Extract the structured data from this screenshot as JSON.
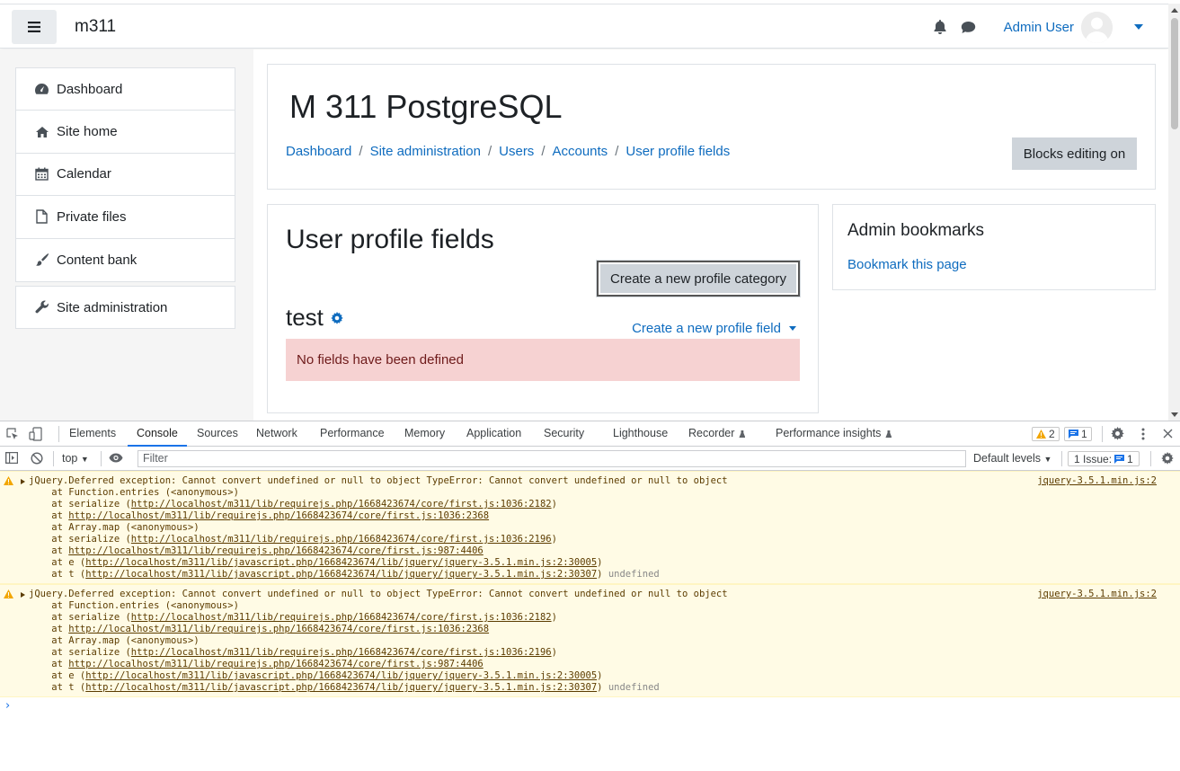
{
  "navbar": {
    "site_name": "m311",
    "user_name": "Admin User"
  },
  "drawer": {
    "items": [
      {
        "label": "Dashboard",
        "icon": "dashboard-icon"
      },
      {
        "label": "Site home",
        "icon": "home-icon"
      },
      {
        "label": "Calendar",
        "icon": "calendar-icon"
      },
      {
        "label": "Private files",
        "icon": "file-icon"
      },
      {
        "label": "Content bank",
        "icon": "paintbrush-icon"
      }
    ],
    "admin": {
      "label": "Site administration",
      "icon": "wrench-icon"
    }
  },
  "header": {
    "title": "M 311 PostgreSQL",
    "breadcrumb": [
      "Dashboard",
      "Site administration",
      "Users",
      "Accounts",
      "User profile fields"
    ],
    "blocks_editing_label": "Blocks editing on"
  },
  "content": {
    "heading": "User profile fields",
    "create_category_label": "Create a new profile category",
    "category_name": "test",
    "create_field_label": "Create a new profile field",
    "alert": "No fields have been defined"
  },
  "bookmarks": {
    "title": "Admin bookmarks",
    "link": "Bookmark this page"
  },
  "devtools": {
    "tabs": [
      "Elements",
      "Console",
      "Sources",
      "Network",
      "Performance",
      "Memory",
      "Application",
      "Security",
      "Lighthouse",
      "Recorder",
      "Performance insights"
    ],
    "active_tab": "Console",
    "warnings_count": "2",
    "messages_count": "1",
    "context": "top",
    "filter_placeholder": "Filter",
    "levels": "Default levels",
    "issues_label": "1 Issue:",
    "issues_count": "1",
    "messages": [
      {
        "text": "jQuery.Deferred exception: Cannot convert undefined or null to object TypeError: Cannot convert undefined or null to object",
        "source": "jquery-3.5.1.min.js:2",
        "stack": [
          {
            "pre": "    at Function.entries (<anonymous>)",
            "link": "",
            "post": ""
          },
          {
            "pre": "    at serialize (",
            "link": "http://localhost/m311/lib/requirejs.php/1668423674/core/first.js:1036:2182",
            "post": ")"
          },
          {
            "pre": "    at ",
            "link": "http://localhost/m311/lib/requirejs.php/1668423674/core/first.js:1036:2368",
            "post": ""
          },
          {
            "pre": "    at Array.map (<anonymous>)",
            "link": "",
            "post": ""
          },
          {
            "pre": "    at serialize (",
            "link": "http://localhost/m311/lib/requirejs.php/1668423674/core/first.js:1036:2196",
            "post": ")"
          },
          {
            "pre": "    at ",
            "link": "http://localhost/m311/lib/requirejs.php/1668423674/core/first.js:987:4406",
            "post": ""
          },
          {
            "pre": "    at e (",
            "link": "http://localhost/m311/lib/javascript.php/1668423674/lib/jquery/jquery-3.5.1.min.js:2:30005",
            "post": ")"
          },
          {
            "pre": "    at t (",
            "link": "http://localhost/m311/lib/javascript.php/1668423674/lib/jquery/jquery-3.5.1.min.js:2:30307",
            "post": ")",
            "tail": "undefined"
          }
        ]
      },
      {
        "text": "jQuery.Deferred exception: Cannot convert undefined or null to object TypeError: Cannot convert undefined or null to object",
        "source": "jquery-3.5.1.min.js:2",
        "stack": [
          {
            "pre": "    at Function.entries (<anonymous>)",
            "link": "",
            "post": ""
          },
          {
            "pre": "    at serialize (",
            "link": "http://localhost/m311/lib/requirejs.php/1668423674/core/first.js:1036:2182",
            "post": ")"
          },
          {
            "pre": "    at ",
            "link": "http://localhost/m311/lib/requirejs.php/1668423674/core/first.js:1036:2368",
            "post": ""
          },
          {
            "pre": "    at Array.map (<anonymous>)",
            "link": "",
            "post": ""
          },
          {
            "pre": "    at serialize (",
            "link": "http://localhost/m311/lib/requirejs.php/1668423674/core/first.js:1036:2196",
            "post": ")"
          },
          {
            "pre": "    at ",
            "link": "http://localhost/m311/lib/requirejs.php/1668423674/core/first.js:987:4406",
            "post": ""
          },
          {
            "pre": "    at e (",
            "link": "http://localhost/m311/lib/javascript.php/1668423674/lib/jquery/jquery-3.5.1.min.js:2:30005",
            "post": ")"
          },
          {
            "pre": "    at t (",
            "link": "http://localhost/m311/lib/javascript.php/1668423674/lib/jquery/jquery-3.5.1.min.js:2:30307",
            "post": ")",
            "tail": "undefined"
          }
        ]
      }
    ],
    "prompt": "›"
  },
  "colors": {
    "link": "#0f6cbf",
    "alert_bg": "#f6d2d2",
    "alert_text": "#6e1a1a",
    "warning_bg": "#fffbe5",
    "devtools_accent": "#1a73e8"
  }
}
